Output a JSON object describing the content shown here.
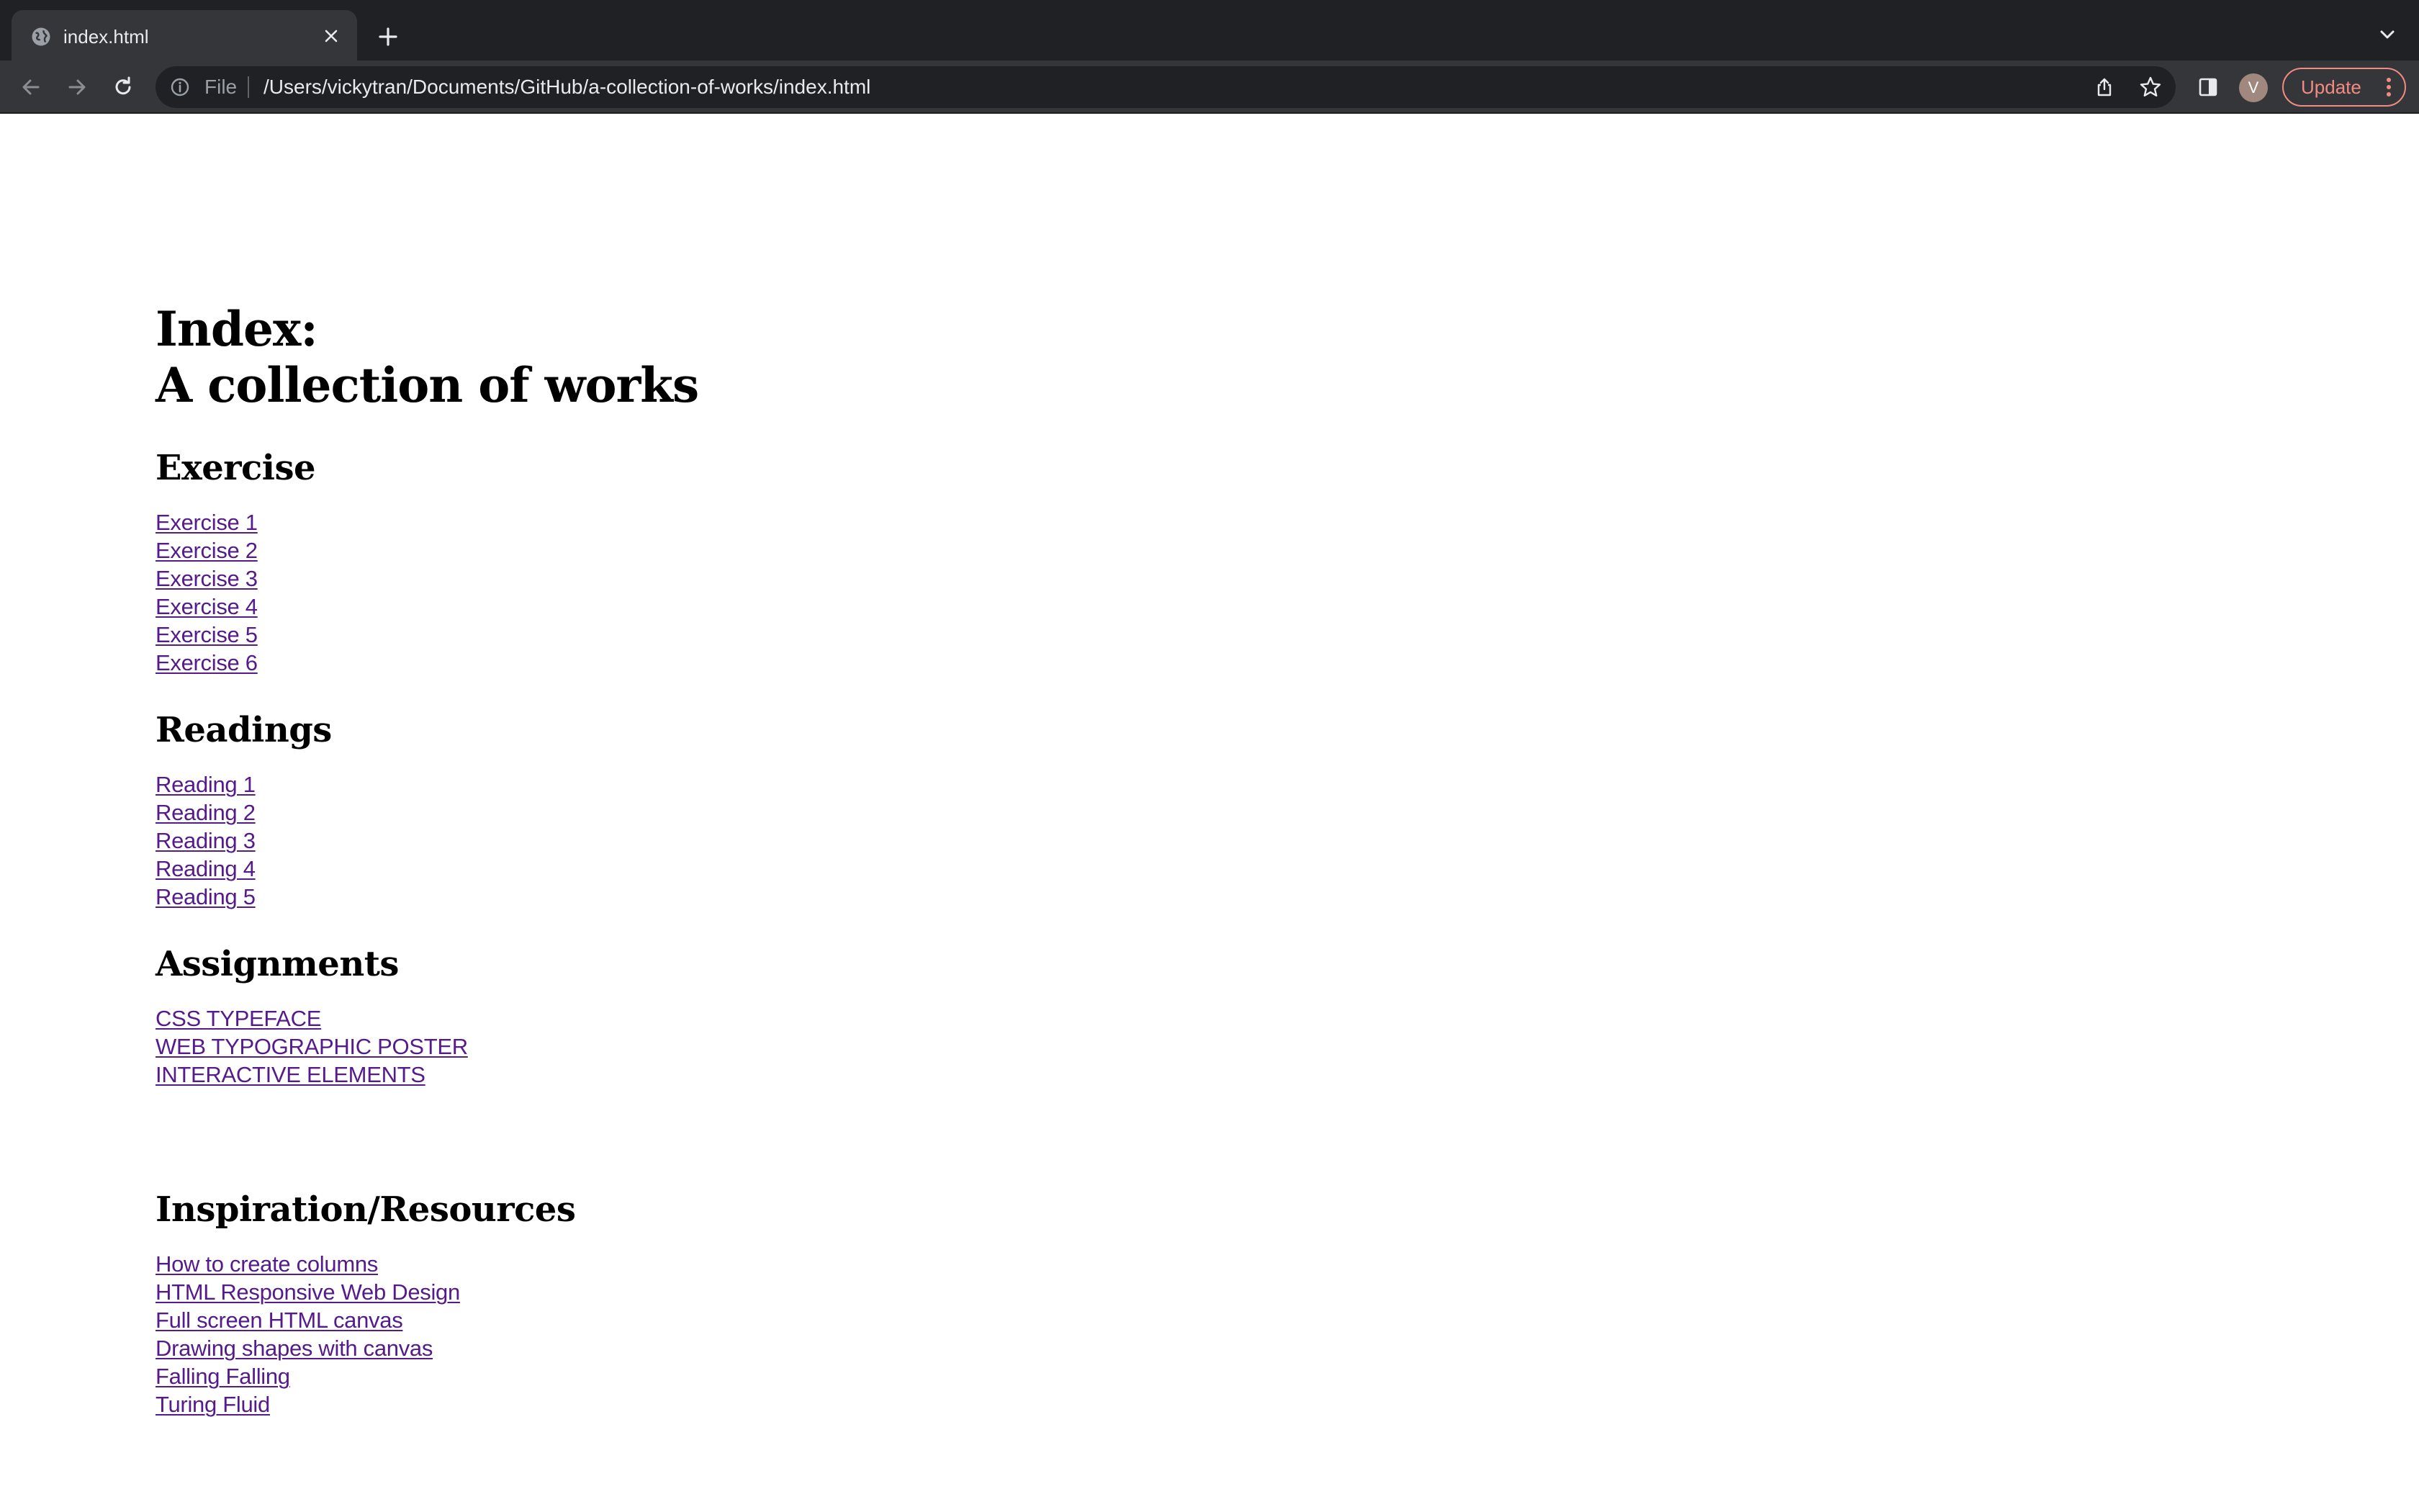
{
  "browser": {
    "tab_title": "index.html",
    "omnibox_scheme": "File",
    "url": "/Users/vickytran/Documents/GitHub/a-collection-of-works/index.html",
    "profile_initial": "V",
    "update_label": "Update",
    "accent_update": "#f28b82"
  },
  "page": {
    "title_line1": "Index:",
    "title_line2": "A collection of works",
    "link_color": "#551a8b",
    "sections": {
      "exercise": {
        "heading": "Exercise",
        "links": [
          "Exercise 1",
          "Exercise 2",
          "Exercise 3",
          "Exercise 4",
          "Exercise 5",
          "Exercise 6"
        ]
      },
      "readings": {
        "heading": "Readings",
        "links": [
          "Reading 1",
          "Reading 2",
          "Reading 3",
          "Reading 4",
          "Reading 5"
        ]
      },
      "assignments": {
        "heading": "Assignments",
        "links": [
          "CSS TYPEFACE",
          "WEB TYPOGRAPHIC POSTER",
          "INTERACTIVE ELEMENTS"
        ]
      },
      "inspiration": {
        "heading": "Inspiration/Resources",
        "links": [
          "How to create columns",
          "HTML Responsive Web Design",
          "Full screen HTML canvas",
          "Drawing shapes with canvas",
          "Falling Falling",
          "Turing Fluid"
        ]
      }
    }
  }
}
